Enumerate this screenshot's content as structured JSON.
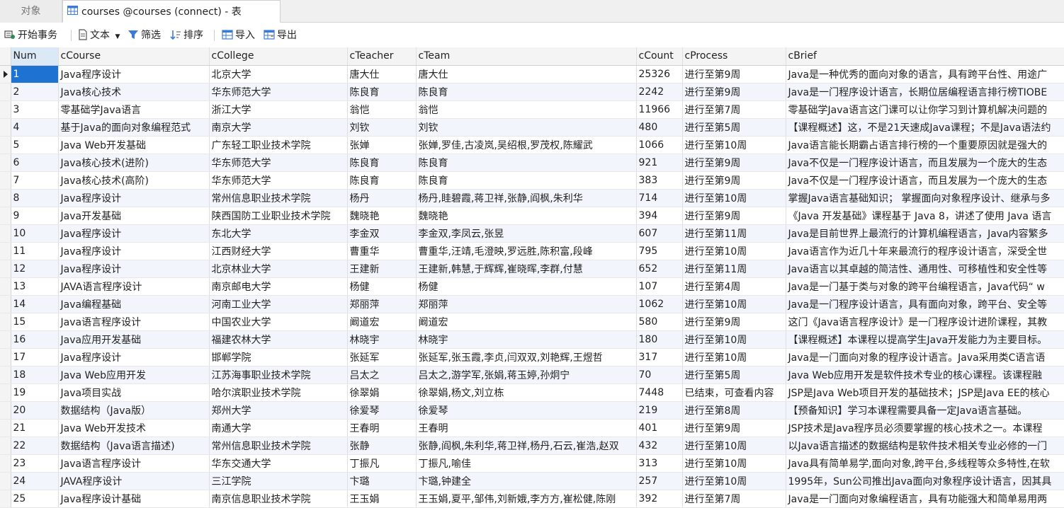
{
  "tabs": {
    "objects": "对象",
    "active": "courses @courses (connect) - 表"
  },
  "toolbar": {
    "begin_transaction": "开始事务",
    "text": "文本",
    "filter": "筛选",
    "sort": "排序",
    "import": "导入",
    "export": "导出"
  },
  "colors": {
    "selected_cell": "#1e73d2",
    "row_stripe": "#f2f6fc",
    "header_bg": "#f4f4f4"
  },
  "columns": [
    "Num",
    "cCourse",
    "cCollege",
    "cTeacher",
    "cTeam",
    "cCount",
    "cProcess",
    "cBrief"
  ],
  "rows": [
    [
      "1",
      "Java程序设计",
      "北京大学",
      "唐大仕",
      "唐大仕",
      "25326",
      "进行至第9周",
      "Java是一种优秀的面向对象的语言，具有跨平台性、用途广"
    ],
    [
      "2",
      "Java核心技术",
      "华东师范大学",
      "陈良育",
      "陈良育",
      "2242",
      "进行至第9周",
      "Java是一门程序设计语言，长期位居编程语言排行榜TIOBE"
    ],
    [
      "3",
      "零基础学Java语言",
      "浙江大学",
      "翁恺",
      "翁恺",
      "11966",
      "进行至第7周",
      "零基础学Java语言这门课可以让你学习到计算机解决问题的"
    ],
    [
      "4",
      "基于Java的面向对象编程范式",
      "南京大学",
      "刘钦",
      "刘钦",
      "480",
      "进行至第5周",
      "【课程概述】这，不是21天速成Java课程；不是Java语法约"
    ],
    [
      "5",
      "Java Web开发基础",
      "广东轻工职业技术学院",
      "张婵",
      "张婵,罗佳,古凌岚,吴绍根,罗茂权,陈耀武",
      "1066",
      "进行至第10周",
      "Java语言能长期霸占语言排行榜的一个重要原因就是强大的"
    ],
    [
      "6",
      "Java核心技术(进阶)",
      "华东师范大学",
      "陈良育",
      "陈良育",
      "921",
      "进行至第9周",
      "Java不仅是一门程序设计语言，而且发展为一个庞大的生态"
    ],
    [
      "7",
      "Java核心技术(高阶)",
      "华东师范大学",
      "陈良育",
      "陈良育",
      "383",
      "进行至第9周",
      "Java不仅是一门程序设计语言，而且发展为一个庞大的生态"
    ],
    [
      "8",
      "Java程序设计",
      "常州信息职业技术学院",
      "杨丹",
      "杨丹,眭碧霞,蒋卫祥,张静,阎枫,朱利华",
      "714",
      "进行至第10周",
      "掌握Java语言基础知识； 掌握面向对象程序设计、继承与多"
    ],
    [
      "9",
      "Java开发基础",
      "陕西国防工业职业技术学院",
      "魏晓艳",
      "魏晓艳",
      "394",
      "进行至第9周",
      "《Java 开发基础》课程基于 Java 8，讲述了使用 Java 语言"
    ],
    [
      "10",
      "Java程序设计",
      "东北大学",
      "李金双",
      "李金双,李凤云,张昱",
      "607",
      "进行至第11周",
      "Java是目前世界上最流行的计算机编程语言，Java内容繁多"
    ],
    [
      "11",
      "Java程序设计",
      "江西财经大学",
      "曹重华",
      "曹重华,汪靖,毛澄映,罗远胜,陈积富,段峰",
      "795",
      "进行至第10周",
      "Java语言作为近几十年来最流行的程序设计语言，深受全世"
    ],
    [
      "12",
      "Java程序设计",
      "北京林业大学",
      "王建新",
      "王建新,韩慧,于辉辉,崔晓晖,李群,付慧",
      "652",
      "进行至第11周",
      "Java语言以其卓越的简洁性、通用性、可移植性和安全性等"
    ],
    [
      "13",
      "JAVA语言程序设计",
      "南京邮电大学",
      "杨健",
      "杨健",
      "107",
      "进行至第4周",
      "Java是一门基于类与对象的跨平台编程语言，Java代码“ w"
    ],
    [
      "14",
      "Java编程基础",
      "河南工业大学",
      "郑丽萍",
      "郑丽萍",
      "1062",
      "进行至第10周",
      "Java是一门程序设计语言，具有面向对象，跨平台、安全等"
    ],
    [
      "15",
      "Java语言程序设计",
      "中国农业大学",
      "阚道宏",
      "阚道宏",
      "580",
      "进行至第9周",
      "这门《Java语言程序设计》是一门程序设计进阶课程，其教"
    ],
    [
      "16",
      "Java应用开发基础",
      "福建农林大学",
      "林晓宇",
      "林晓宇",
      "180",
      "进行至第10周",
      "【课程概述】本课程以提高学生Java开发能力为主要目标。"
    ],
    [
      "17",
      "Java程序设计",
      "邯郸学院",
      "张延军",
      "张延军,张玉霞,李贞,闫双双,刘艳辉,王煜哲",
      "317",
      "进行至第10周",
      "Java是一门面向对象的程序设计语言。Java采用类C语言语"
    ],
    [
      "18",
      "Java Web应用开发",
      "江苏海事职业技术学院",
      "吕太之",
      "吕太之,游学军,张娟,蒋玉婷,孙炯宁",
      "70",
      "进行至第5周",
      "Java Web应用开发是软件技术专业的核心课程。该课程融"
    ],
    [
      "19",
      "Java项目实战",
      "哈尔滨职业技术学院",
      "徐翠娟",
      "徐翠娟,杨文,刘立栋",
      "7448",
      "已结束，可查看内容",
      "JSP是Java Web项目开发的基础技术；JSP是Java EE的核心"
    ],
    [
      "20",
      "数据结构（Java版）",
      "郑州大学",
      "徐爱琴",
      "徐爱琴",
      "219",
      "进行至第8周",
      "【预备知识】学习本课程需要具备一定Java语言基础。"
    ],
    [
      "21",
      "Java Web开发技术",
      "南通大学",
      "王春明",
      "王春明",
      "401",
      "进行至第9周",
      "JSP技术是Java程序员必须要掌握的核心技术之一。本课程"
    ],
    [
      "22",
      "数据结构（Java语言描述)",
      "常州信息职业技术学院",
      "张静",
      "张静,阎枫,朱利华,蒋卫祥,杨丹,石云,崔浩,赵双",
      "432",
      "进行至第10周",
      "以Java语言描述的数据结构是软件技术相关专业必修的一门"
    ],
    [
      "23",
      "Java语言程序设计",
      "华东交通大学",
      "丁振凡",
      "丁振凡,喻佳",
      "313",
      "进行至第10周",
      "Java具有简单易学,面向对象,跨平台,多线程等众多特性,在软"
    ],
    [
      "24",
      "JAVA程序设计",
      "三江学院",
      "卞璐",
      "卞璐,钟建全",
      "257",
      "进行至第10周",
      "1995年，Sun公司推出Java面向对象程序设计语言，因其具"
    ],
    [
      "25",
      "Java程序设计基础",
      "南京信息职业技术学院",
      "王玉娟",
      "王玉娟,夏平,邹伟,刘新娥,李方方,崔松健,陈刚",
      "392",
      "进行至第7周",
      "Java是一门面向对象编程语言，具有功能强大和简单易用两"
    ]
  ]
}
